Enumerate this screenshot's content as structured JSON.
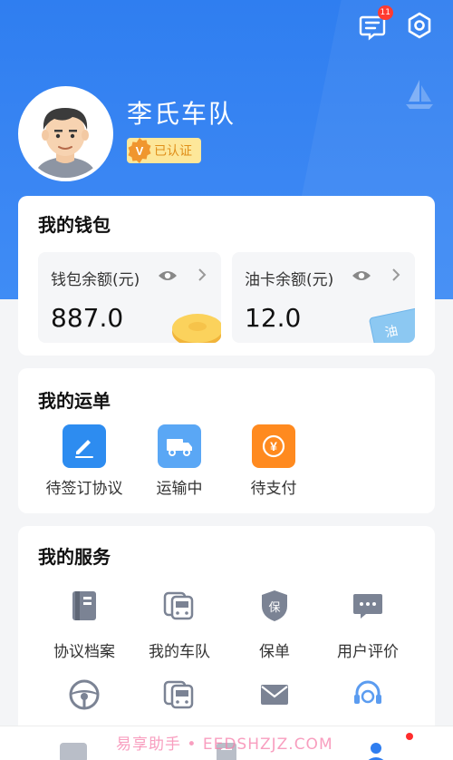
{
  "header": {
    "message_badge": "11",
    "icons": [
      "message-icon",
      "settings-icon",
      "sailboat-icon"
    ]
  },
  "profile": {
    "name": "李氏车队",
    "verified_label": "已认证",
    "verified_mark": "V"
  },
  "wallet": {
    "title": "我的钱包",
    "wallet_balance": {
      "label": "钱包余额(元)",
      "value": "887.0"
    },
    "fuel_card_balance": {
      "label": "油卡余额(元)",
      "value": "12.0",
      "card_text": "油"
    }
  },
  "waybill": {
    "title": "我的运单",
    "items": [
      {
        "label": "待签订协议",
        "icon": "sign-pen-icon",
        "color": "#2d8cf0"
      },
      {
        "label": "运输中",
        "icon": "truck-icon",
        "color": "#5aa7f5"
      },
      {
        "label": "待支付",
        "icon": "yuan-icon",
        "color": "#ff8a1f",
        "glyph": "¥"
      }
    ]
  },
  "services": {
    "title": "我的服务",
    "items": [
      {
        "label": "协议档案",
        "icon": "document-icon"
      },
      {
        "label": "我的车队",
        "icon": "bus-fleet-icon"
      },
      {
        "label": "保单",
        "icon": "shield-icon",
        "glyph": "保"
      },
      {
        "label": "用户评价",
        "icon": "chat-bubble-icon"
      },
      {
        "label": "",
        "icon": "steering-wheel-icon"
      },
      {
        "label": "",
        "icon": "bus-fleet-icon"
      },
      {
        "label": "",
        "icon": "mail-icon"
      },
      {
        "label": "",
        "icon": "customer-service-icon"
      }
    ]
  },
  "watermark": "易享助手 • EEDSHZJZ.COM",
  "colors": {
    "brand_blue": "#2f7ef0",
    "badge_red": "#ff3b30",
    "gold": "#fde79a",
    "icon_gray": "#7b8394"
  }
}
